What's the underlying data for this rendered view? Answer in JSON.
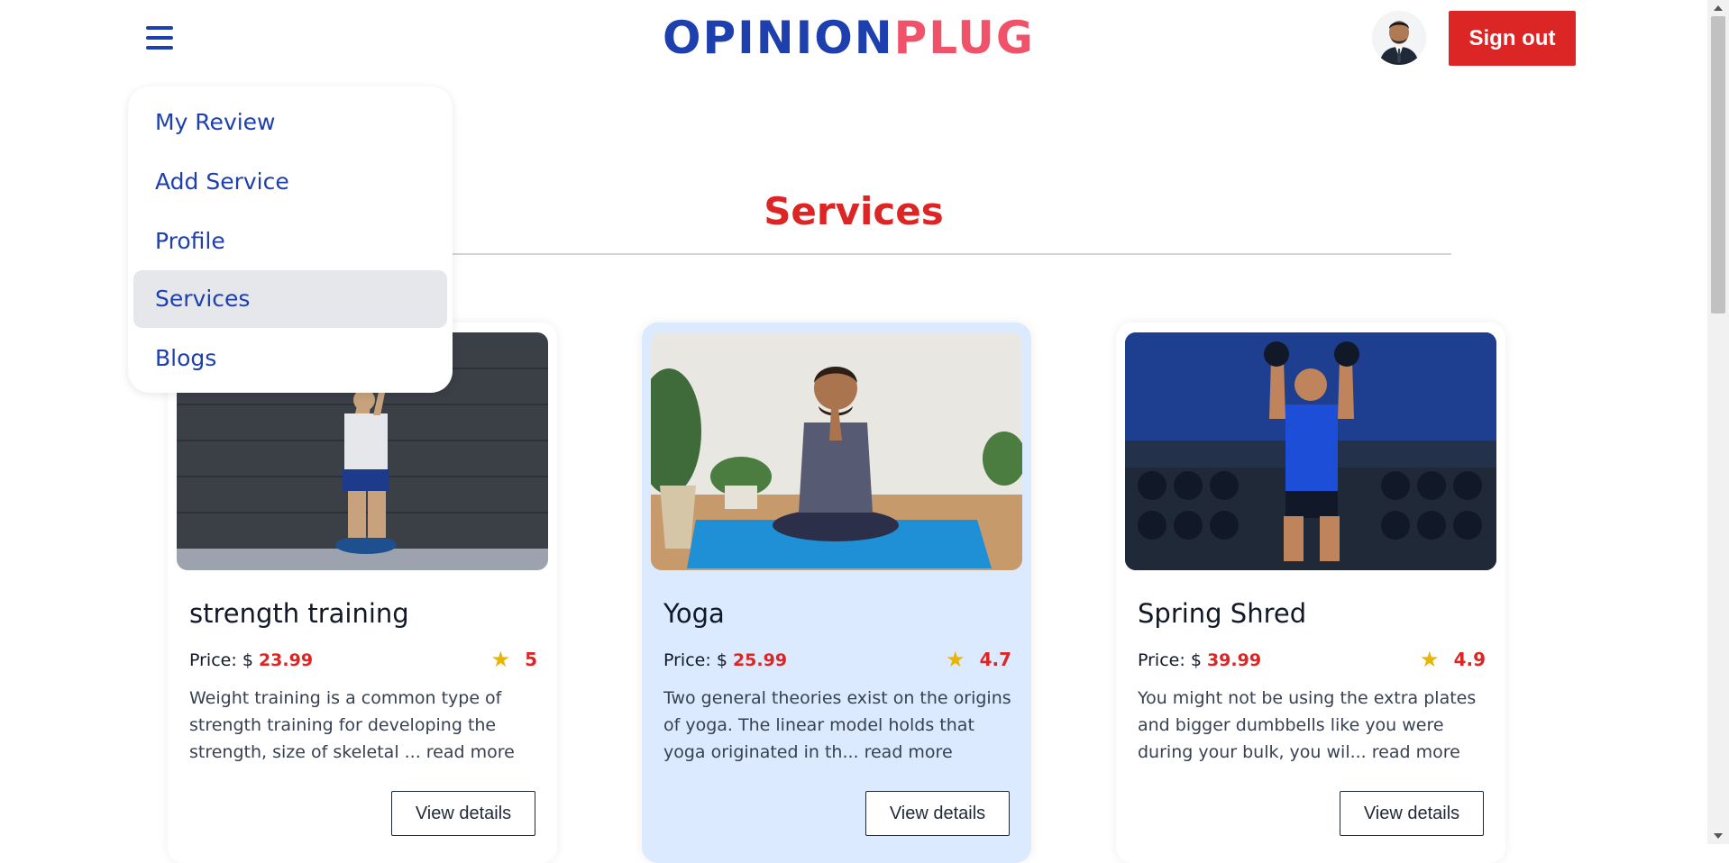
{
  "header": {
    "logo_part1": "OPINION",
    "logo_part2": "PLUG",
    "signout_label": "Sign out",
    "avatar_alt": "User avatar",
    "menu_icon": "hamburger-menu-icon"
  },
  "menu": {
    "items": [
      {
        "label": "My Review",
        "active": false
      },
      {
        "label": "Add Service",
        "active": false
      },
      {
        "label": "Profile",
        "active": false
      },
      {
        "label": "Services",
        "active": true
      },
      {
        "label": "Blogs",
        "active": false
      }
    ]
  },
  "main": {
    "title": "Services"
  },
  "cards": [
    {
      "name": "strength training",
      "price_label": "Price:",
      "price_prefix": "$",
      "price": "23.99",
      "rating": "5",
      "description": "Weight training is a common type of strength training for developing the strength, size of skeletal ... read more",
      "button": "View details",
      "highlight": false
    },
    {
      "name": "Yoga",
      "price_label": "Price:",
      "price_prefix": "$",
      "price": "25.99",
      "rating": "4.7",
      "description": "Two general theories exist on the origins of yoga. The linear model holds that yoga originated in th... read more",
      "button": "View details",
      "highlight": true
    },
    {
      "name": "Spring Shred",
      "price_label": "Price:",
      "price_prefix": "$",
      "price": "39.99",
      "rating": "4.9",
      "description": "You might not be using the extra plates and bigger dumbbells like you were during your bulk, you wil... read more",
      "button": "View details",
      "highlight": false
    }
  ],
  "colors": {
    "brand_blue": "#1e40af",
    "brand_pink": "#f0526a",
    "accent_red": "#dc2626",
    "card_highlight": "#dbeafe",
    "star": "#eab308"
  }
}
